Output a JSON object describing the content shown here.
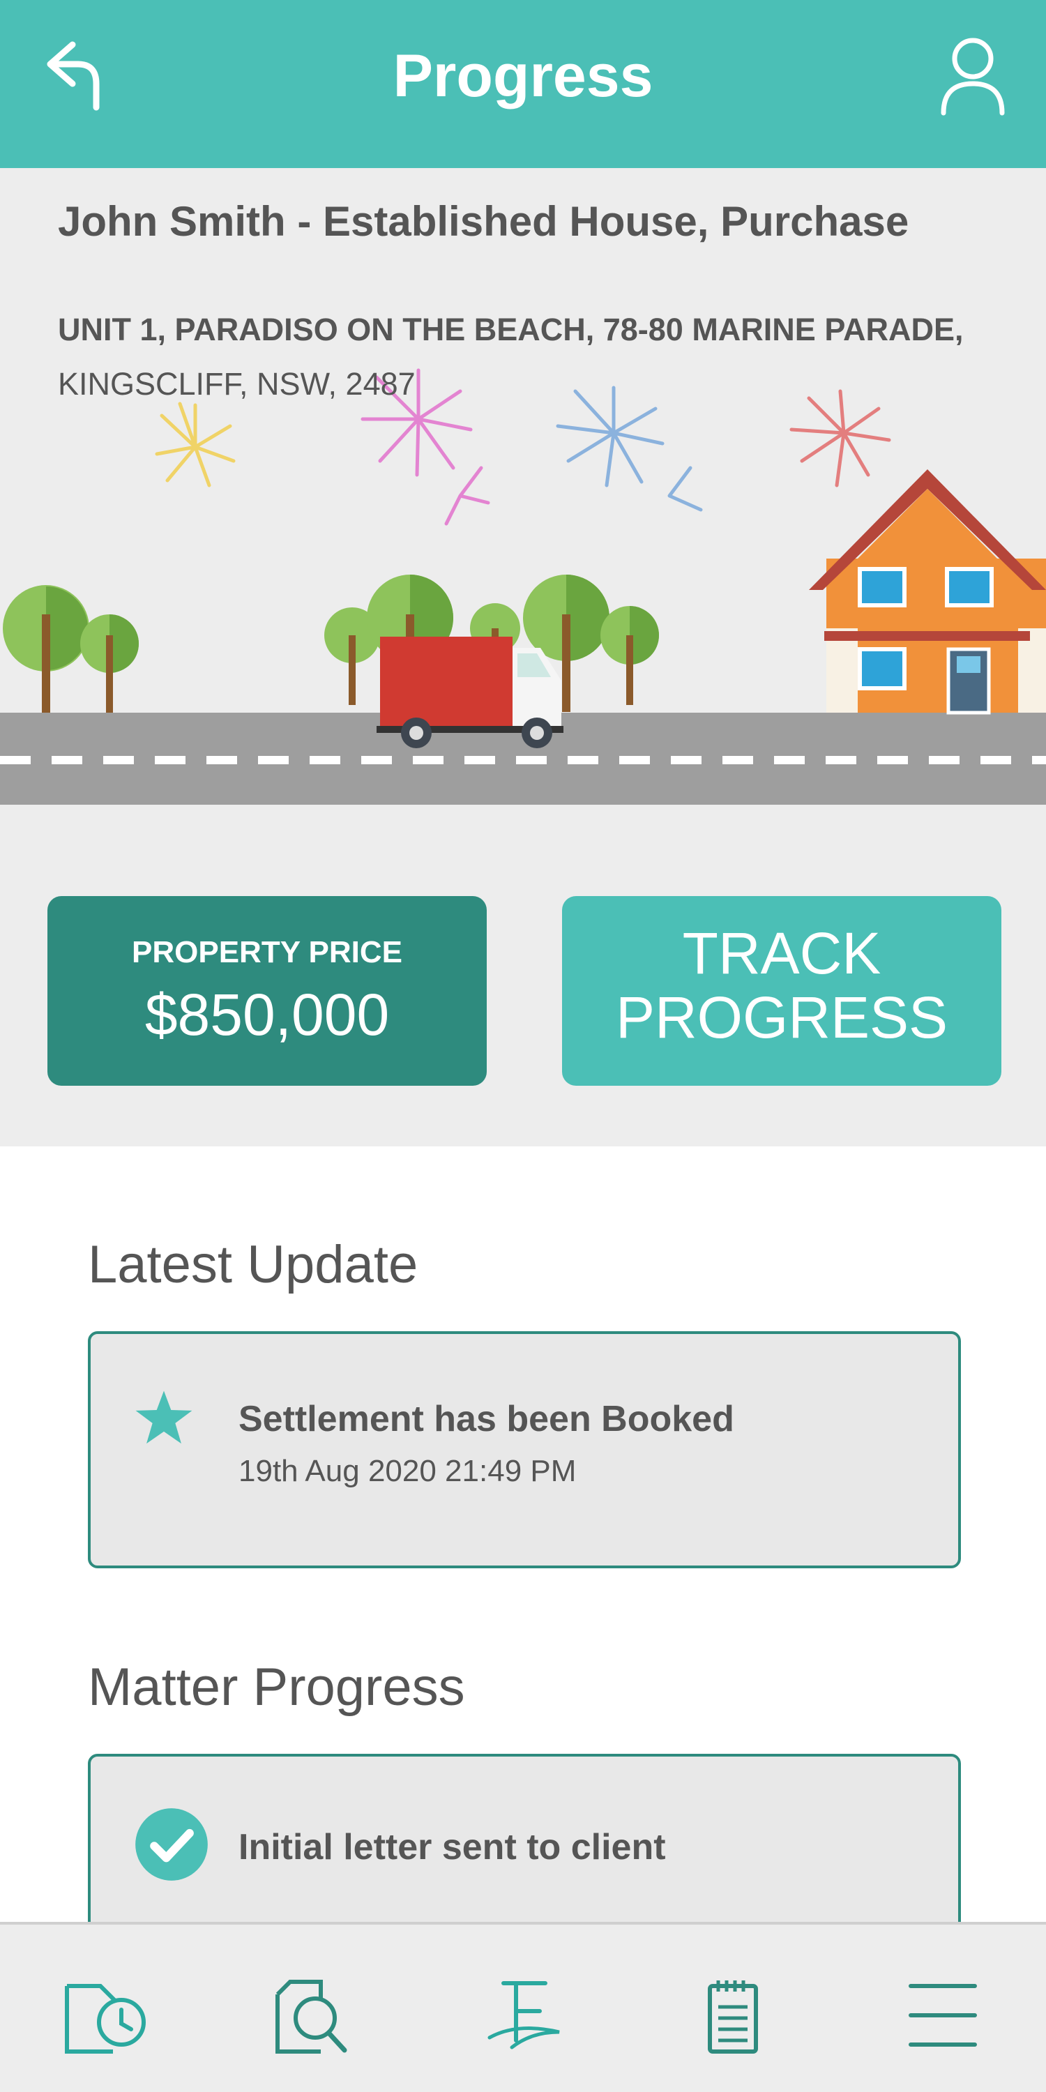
{
  "header": {
    "title": "Progress",
    "back_icon": "back-arrow-icon",
    "profile_icon": "user-profile-icon",
    "color": "#4bbfb6"
  },
  "hero": {
    "matter_title": "John Smith - Established House, Purchase",
    "address_line1": "UNIT 1, PARADISO ON THE BEACH, 78-80 MARINE PARADE,",
    "address_line2": "KINGSCLIFF, NSW, 2487"
  },
  "price": {
    "label": "PROPERTY PRICE",
    "value": "$850,000",
    "color": "#2e8b7e"
  },
  "track_button": {
    "line1": "TRACK",
    "line2": "PROGRESS"
  },
  "latest_update": {
    "heading": "Latest Update",
    "icon": "star-icon",
    "text": "Settlement has been Booked",
    "timestamp": "19th Aug 2020 21:49 PM"
  },
  "matter_progress": {
    "heading": "Matter Progress",
    "items": [
      {
        "icon": "check-circle-icon",
        "text": "Initial letter sent to client"
      }
    ]
  },
  "bottom_nav": {
    "items": [
      {
        "icon": "document-clock-icon"
      },
      {
        "icon": "document-search-icon"
      },
      {
        "icon": "finance-logo-icon"
      },
      {
        "icon": "clipboard-notes-icon"
      },
      {
        "icon": "menu-icon"
      }
    ]
  }
}
